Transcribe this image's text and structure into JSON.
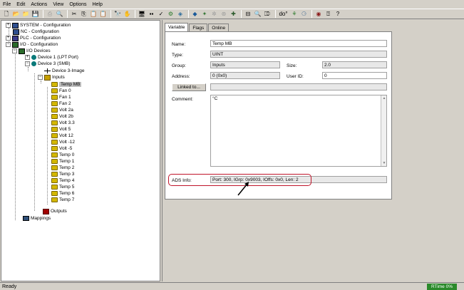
{
  "menu": [
    "File",
    "Edit",
    "Actions",
    "View",
    "Options",
    "Help"
  ],
  "toolbar_icons": [
    "new-icon",
    "open-icon",
    "open-folder-icon",
    "save-icon",
    "print-icon",
    "print-preview-icon",
    "cut-icon",
    "copy-icon",
    "paste-icon",
    "paste-special-icon",
    "find-icon",
    "hand-icon",
    "monitor-icon",
    "dots-icon",
    "check-icon",
    "build-icon",
    "activate-icon",
    "target-icon",
    "wand-icon",
    "gear-icon",
    "network-icon",
    "search-icon",
    "zoom-icon",
    "goto-icon",
    "degree-icon",
    "check-config-icon",
    "link-icon",
    "diamond-icon",
    "help-book-icon",
    "context-help-icon"
  ],
  "tree": {
    "system": "SYSTEM - Configuration",
    "nc": "NC - Configuration",
    "plc": "PLC - Configuration",
    "io": "I/O - Configuration",
    "io_devices": "I/O Devices",
    "device1": "Device 1 (LPT Port)",
    "device3": "Device 3 (SMB)",
    "device3_image": "Device 3-Image",
    "inputs": "Inputs",
    "variables": [
      "Temp MB",
      "Fan 0",
      "Fan 1",
      "Fan 2",
      "Volt 2a",
      "Volt 2b",
      "Volt 3.3",
      "Volt 5",
      "Volt 12",
      "Volt -12",
      "Volt -5",
      "Temp 0",
      "Temp 1",
      "Temp 2",
      "Temp 3",
      "Temp 4",
      "Temp 5",
      "Temp 6",
      "Temp 7"
    ],
    "outputs": "Outputs",
    "mappings": "Mappings"
  },
  "tabs": [
    "Variable",
    "Flags",
    "Online"
  ],
  "form": {
    "name_label": "Name:",
    "name_value": "Temp MB",
    "type_label": "Type:",
    "type_value": "UINT",
    "group_label": "Group:",
    "group_value": "Inputs",
    "size_label": "Size:",
    "size_value": "2.0",
    "address_label": "Address:",
    "address_value": "0 (0x0)",
    "userid_label": "User ID:",
    "userid_value": "0",
    "linked_button": "Linked to...",
    "linked_value": "",
    "comment_label": "Comment:",
    "comment_value": "°C",
    "ads_label": "ADS Info:",
    "ads_value": "Port: 300, IGrp: 0x9003, IOffs: 0x0, Len: 2"
  },
  "status": {
    "left": "Ready",
    "rtime": "RTime 0%"
  },
  "colors": {
    "highlight": "#c0152a",
    "rtime_bg": "#2a8a2a"
  }
}
